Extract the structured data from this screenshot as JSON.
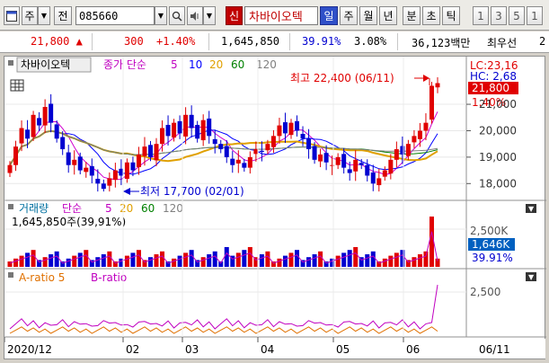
{
  "toolbar": {
    "code_label": "주",
    "prev_label": "전",
    "stock_code": "085660",
    "new_badge": "신",
    "stock_name": "차바이오텍",
    "periods": [
      "일",
      "주",
      "월",
      "년",
      "분",
      "초",
      "틱"
    ],
    "active_period": "일",
    "nums": [
      "1",
      "3",
      "5",
      "1"
    ]
  },
  "quote": {
    "price": "21,800",
    "change": "300",
    "change_pct": "+1.40%",
    "volume": "1,645,850",
    "vol_ratio": "39.91%",
    "turnover": "3.08%",
    "amount": "36,123백만",
    "related": "최우선",
    "tail": "2"
  },
  "price_panel": {
    "legend_name": "차바이오텍",
    "legend_close": "종가 단순",
    "ma_periods": [
      "5",
      "10",
      "20",
      "60",
      "120"
    ],
    "high_label": "최고 22,400 (06/11)",
    "low_label": "최저 17,700 (02/01)",
    "lc": "LC:23,16",
    "hc": "HC: 2,68",
    "last_price": "21,800",
    "last_pct": "1.40%",
    "y_ticks": [
      "21,000",
      "20,000",
      "19,000",
      "18,000"
    ],
    "colors": {
      "up": "#e00000",
      "down": "#0000d0",
      "ma5": "#d000d0",
      "ma10": "#0000ff",
      "ma20": "#e0a000",
      "ma60": "#008000",
      "ma120": "#808080"
    }
  },
  "volume_panel": {
    "legend": "거래량",
    "legend_ma": "단순",
    "ma_periods": [
      "5",
      "20",
      "60",
      "120"
    ],
    "value_text": "1,645,850주(39,91%)",
    "y_tick": "2,500K",
    "last_value": "1,646K",
    "last_pct": "39.91%"
  },
  "ratio_panel": {
    "legend_a": "A-ratio 5",
    "legend_b": "B-ratio",
    "y_tick": "2,500"
  },
  "x_axis": {
    "labels": [
      "2020/12",
      "02",
      "03",
      "04",
      "05",
      "06"
    ],
    "cursor_date": "06/11"
  },
  "chart_data": {
    "type": "candlestick",
    "title": "차바이오텍",
    "ylim": [
      17500,
      22600
    ],
    "high": {
      "value": 22400,
      "date": "06/11"
    },
    "low": {
      "value": 17700,
      "date": "02/01"
    },
    "close_series": [
      18700,
      19400,
      20100,
      19700,
      20600,
      20200,
      20900,
      20300,
      19700,
      19300,
      18700,
      18900,
      18500,
      18600,
      18300,
      18000,
      17800,
      18200,
      18500,
      18300,
      18800,
      18500,
      19100,
      19400,
      19000,
      19500,
      20100,
      19800,
      20300,
      19900,
      20600,
      20100,
      19700,
      20400,
      19800,
      19500,
      19300,
      19000,
      18700,
      18900,
      18600,
      19000,
      19300,
      19200,
      19500,
      19800,
      20200,
      19900,
      20300,
      20000,
      19700,
      19300,
      18900,
      19100,
      18800,
      18700,
      19000,
      18600,
      18400,
      18900,
      18700,
      18300,
      18000,
      18200,
      18500,
      18900,
      19300,
      19100,
      19500,
      19800,
      20000,
      20300,
      21700,
      21800
    ]
  }
}
